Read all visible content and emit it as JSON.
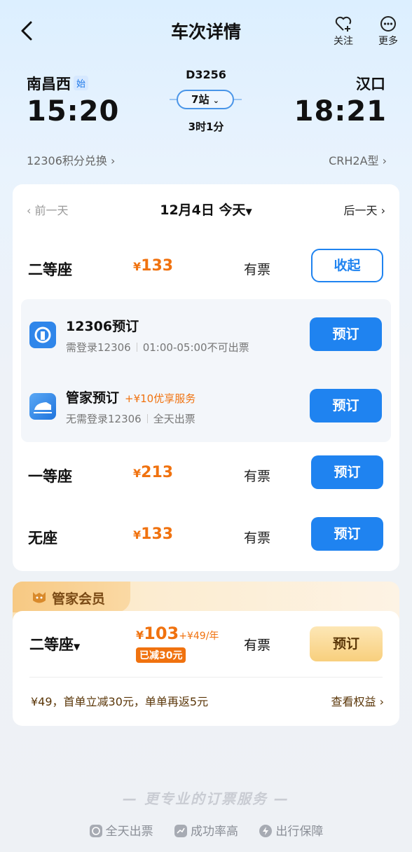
{
  "header": {
    "title": "车次详情",
    "follow_label": "关注",
    "more_label": "更多"
  },
  "route": {
    "from_station": "南昌西",
    "start_tag": "始",
    "depart_time": "15:20",
    "train_no": "D3256",
    "stops": "7站",
    "duration": "3时1分",
    "to_station": "汉口",
    "arrive_time": "18:21",
    "points_link": "12306积分兑换 ›",
    "train_model": "CRH2A型 ›"
  },
  "date_nav": {
    "prev": "‹ 前一天",
    "current": "12月4日 今天",
    "next": "后一天 ›"
  },
  "seats": [
    {
      "name": "二等座",
      "currency": "¥",
      "price": "133",
      "status": "有票",
      "action": "收起"
    },
    {
      "name": "一等座",
      "currency": "¥",
      "price": "213",
      "status": "有票",
      "action": "预订"
    },
    {
      "name": "无座",
      "currency": "¥",
      "price": "133",
      "status": "有票",
      "action": "预订"
    }
  ],
  "booking_options": [
    {
      "title": "12306预订",
      "extra": "",
      "sub1": "需登录12306",
      "sub2": "01:00-05:00不可出票",
      "action": "预订"
    },
    {
      "title": "管家预订",
      "extra": "+¥10优享服务",
      "sub1": "无需登录12306",
      "sub2": "全天出票",
      "action": "预订"
    }
  ],
  "member": {
    "tag": "管家会员",
    "seat": "二等座",
    "currency": "¥",
    "price": "103",
    "fee": "+¥49/年",
    "discount": "已减30元",
    "status": "有票",
    "action": "预订",
    "desc": "¥49，首单立减30元，单单再返5元",
    "benefit_link": "查看权益 ›"
  },
  "footer": {
    "slogan": "— 更专业的订票服务 —",
    "features": [
      "全天出票",
      "成功率高",
      "出行保障"
    ]
  },
  "colors": {
    "primary": "#1f83f0",
    "price": "#f0720f",
    "member_gold": "#f8cf7d"
  }
}
